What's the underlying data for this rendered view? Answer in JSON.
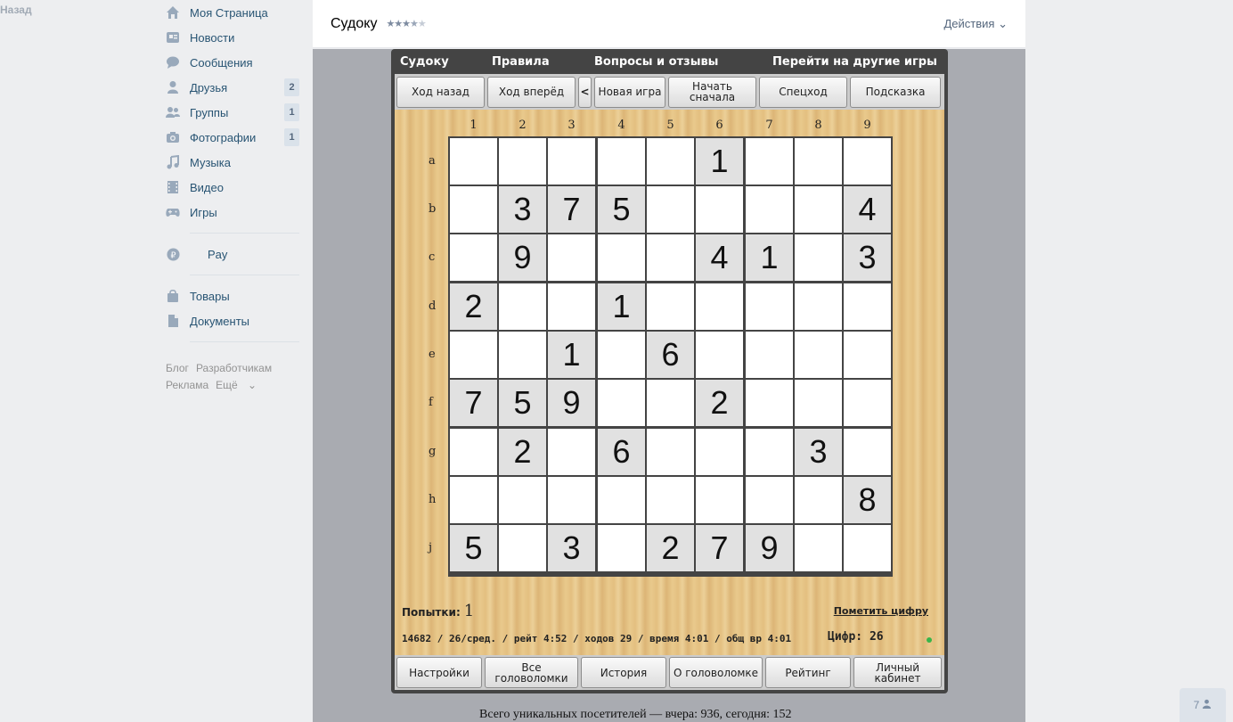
{
  "back": "Назад",
  "sidebar": {
    "items": [
      {
        "label": "Моя Страница",
        "icon": "home-icon"
      },
      {
        "label": "Новости",
        "icon": "news-icon"
      },
      {
        "label": "Сообщения",
        "icon": "messages-icon"
      },
      {
        "label": "Друзья",
        "icon": "friends-icon",
        "badge": "2"
      },
      {
        "label": "Группы",
        "icon": "groups-icon",
        "badge": "1"
      },
      {
        "label": "Фотографии",
        "icon": "camera-icon",
        "badge": "1"
      },
      {
        "label": "Музыка",
        "icon": "music-icon"
      },
      {
        "label": "Видео",
        "icon": "video-icon"
      },
      {
        "label": "Игры",
        "icon": "gamepad-icon"
      }
    ],
    "pay": "Pay",
    "items2": [
      {
        "label": "Товары",
        "icon": "bag-icon"
      },
      {
        "label": "Документы",
        "icon": "document-icon"
      }
    ],
    "footer": [
      "Блог",
      "Разработчикам",
      "Реклама",
      "Ещё"
    ]
  },
  "header": {
    "title": "Судоку",
    "rating": 3.5,
    "actions": "Действия"
  },
  "game": {
    "menu": [
      "Судоку",
      "Правила",
      "Вопросы и отзывы",
      "Перейти на другие игры"
    ],
    "toolbar": [
      "Ход назад",
      "Ход вперёд",
      "<",
      "Новая игра",
      "Начать сначала",
      "Спецход",
      "Подсказка"
    ],
    "columns": [
      "1",
      "2",
      "3",
      "4",
      "5",
      "6",
      "7",
      "8",
      "9"
    ],
    "rows": [
      "a",
      "b",
      "c",
      "d",
      "e",
      "f",
      "g",
      "h",
      "j"
    ],
    "board": [
      [
        "",
        "",
        "",
        "",
        "",
        "1",
        "",
        "",
        ""
      ],
      [
        "",
        "3",
        "7",
        "5",
        "",
        "",
        "",
        "",
        "4"
      ],
      [
        "",
        "9",
        "",
        "",
        "",
        "4",
        "1",
        "",
        "3"
      ],
      [
        "2",
        "",
        "",
        "1",
        "",
        "",
        "",
        "",
        ""
      ],
      [
        "",
        "",
        "1",
        "",
        "6",
        "",
        "",
        "",
        ""
      ],
      [
        "7",
        "5",
        "9",
        "",
        "",
        "2",
        "",
        "",
        ""
      ],
      [
        "",
        "2",
        "",
        "6",
        "",
        "",
        "",
        "3",
        ""
      ],
      [
        "",
        "",
        "",
        "",
        "",
        "",
        "",
        "",
        "8"
      ],
      [
        "5",
        "",
        "3",
        "",
        "2",
        "7",
        "9",
        "",
        ""
      ]
    ],
    "attempts_label": "Попытки:",
    "attempts": "1",
    "mark_digit": "Пометить цифру",
    "stats": "14682 / 26/сред. / рейт 4:52 / ходов 29 / время 4:01 / общ вр 4:01",
    "digits": "Цифр: 26",
    "bottom": [
      "Настройки",
      "Все головоломки",
      "История",
      "О головоломке",
      "Рейтинг",
      "Личный кабинет"
    ]
  },
  "visitors": "Всего уникальных посетителей — вчера: 936, сегодня: 152",
  "chat_count": "7"
}
